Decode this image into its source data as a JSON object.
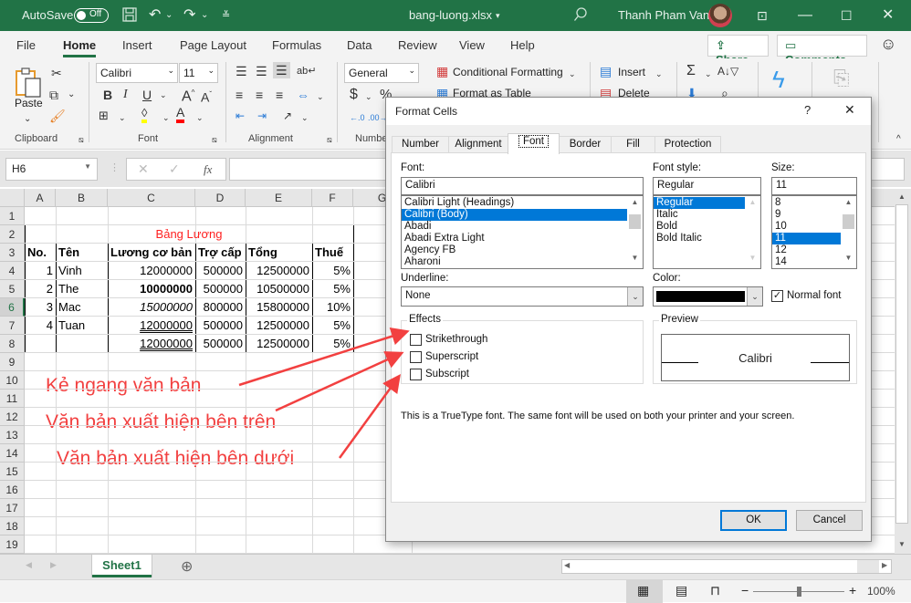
{
  "titlebar": {
    "autosave_label": "AutoSave",
    "autosave_state": "Off",
    "filename": "bang-luong.xlsx",
    "user_name": "Thanh Pham Van",
    "theme_color": "#217346"
  },
  "menu": {
    "items": [
      "File",
      "Home",
      "Insert",
      "Page Layout",
      "Formulas",
      "Data",
      "Review",
      "View",
      "Help"
    ],
    "active": "Home",
    "share_label": "Share",
    "comments_label": "Comments"
  },
  "ribbon": {
    "clipboard": {
      "paste_label": "Paste",
      "group_label": "Clipboard"
    },
    "font": {
      "font_name": "Calibri",
      "font_size": "11",
      "group_label": "Font",
      "highlight_color": "#ffff00",
      "font_color": "#ff0000"
    },
    "alignment": {
      "group_label": "Alignment"
    },
    "number": {
      "format": "General",
      "group_label": "Number"
    },
    "styles": {
      "conditional_formatting": "Conditional Formatting",
      "format_as_table": "Format as Table"
    },
    "cells": {
      "insert": "Insert",
      "delete": "Delete"
    }
  },
  "formula_bar": {
    "name_box": "H6",
    "fx_label": "fx",
    "formula": ""
  },
  "sheet": {
    "columns": [
      "A",
      "B",
      "C",
      "D",
      "E",
      "F",
      "G"
    ],
    "rows": [
      "1",
      "2",
      "3",
      "4",
      "5",
      "6",
      "7",
      "8",
      "9",
      "10",
      "11",
      "12",
      "13",
      "14",
      "15",
      "16",
      "17",
      "18",
      "19"
    ],
    "selected_row": "6",
    "title": "Bảng Lương",
    "headers": [
      "No.",
      "Tên",
      "Lương cơ bản",
      "Trợ cấp",
      "Tổng",
      "Thuế"
    ],
    "data": [
      [
        "1",
        "Vinh",
        "12000000",
        "500000",
        "12500000",
        "5%"
      ],
      [
        "2",
        "The",
        "10000000",
        "500000",
        "10500000",
        "5%"
      ],
      [
        "3",
        "Mac",
        "15000000",
        "800000",
        "15800000",
        "10%"
      ],
      [
        "4",
        "Tuan",
        "12000000",
        "500000",
        "12500000",
        "5%"
      ],
      [
        "",
        "",
        "12000000",
        "500000",
        "12500000",
        "5%"
      ]
    ],
    "annotations": [
      "Kẻ ngang văn bản",
      "Văn bản xuất hiện bên trên",
      "Văn bản xuất hiện bên dưới"
    ],
    "annotation_color": "#f24040"
  },
  "sheet_tabs": {
    "tabs": [
      "Sheet1"
    ],
    "active": "Sheet1"
  },
  "status": {
    "zoom": "100%"
  },
  "dialog": {
    "title": "Format Cells",
    "help": "?",
    "close": "✕",
    "tabs": [
      "Number",
      "Alignment",
      "Font",
      "Border",
      "Fill",
      "Protection"
    ],
    "active_tab": "Font",
    "font_label": "Font:",
    "font_value": "Calibri",
    "font_list": [
      "Calibri Light (Headings)",
      "Calibri (Body)",
      "Abadi",
      "Abadi Extra Light",
      "Agency FB",
      "Aharoni"
    ],
    "font_selected": "Calibri (Body)",
    "style_label": "Font style:",
    "style_value": "Regular",
    "style_list": [
      "Regular",
      "Italic",
      "Bold",
      "Bold Italic"
    ],
    "style_selected": "Regular",
    "size_label": "Size:",
    "size_value": "11",
    "size_list": [
      "8",
      "9",
      "10",
      "11",
      "12",
      "14"
    ],
    "size_selected": "11",
    "underline_label": "Underline:",
    "underline_value": "None",
    "color_label": "Color:",
    "color_value": "#000000",
    "normal_font_label": "Normal font",
    "normal_font_checked": true,
    "effects_label": "Effects",
    "effects": [
      {
        "label": "Strikethrough",
        "checked": false
      },
      {
        "label": "Superscript",
        "checked": false
      },
      {
        "label": "Subscript",
        "checked": false
      }
    ],
    "preview_label": "Preview",
    "preview_text": "Calibri",
    "info_text": "This is a TrueType font.  The same font will be used on both your printer and your screen.",
    "ok_label": "OK",
    "cancel_label": "Cancel"
  }
}
